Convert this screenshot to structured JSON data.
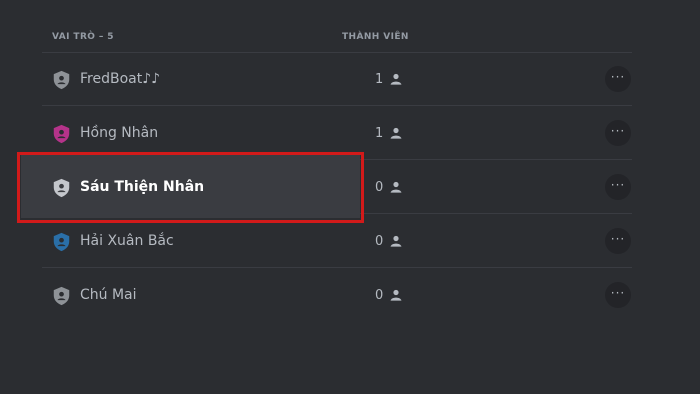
{
  "header": {
    "roles_label": "VAI TRÒ – 5",
    "members_label": "THÀNH VIÊN"
  },
  "roles": [
    {
      "name": "FredBoat♪♪",
      "color": "#8e9297",
      "member_count": "1",
      "selected": false
    },
    {
      "name": "Hồng Nhân",
      "color": "#b5338a",
      "member_count": "1",
      "selected": false
    },
    {
      "name": "Sáu Thiện Nhân",
      "color": "#c4c7cc",
      "member_count": "0",
      "selected": true
    },
    {
      "name": "Hải Xuân Bắc",
      "color": "#2a6fa8",
      "member_count": "0",
      "selected": false
    },
    {
      "name": "Chú Mai",
      "color": "#8e9297",
      "member_count": "0",
      "selected": false
    }
  ],
  "icons": {
    "role": "shield-icon",
    "members": "person-icon",
    "more": "more-options-icon"
  },
  "more_label": "···",
  "highlight_color": "#d21a1a"
}
